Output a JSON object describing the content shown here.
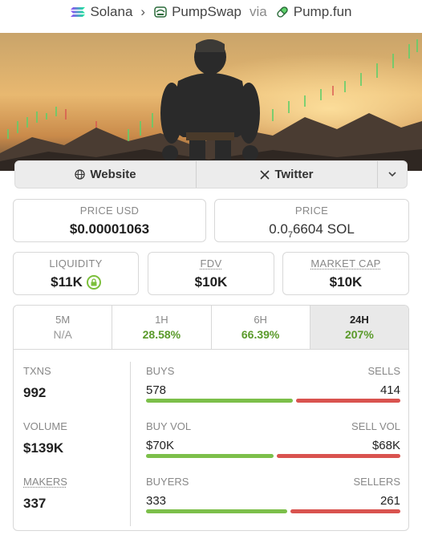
{
  "breadcrumb": {
    "chain": "Solana",
    "dex": "PumpSwap",
    "via": "via",
    "source": "Pump.fun"
  },
  "links": {
    "website": "Website",
    "twitter": "Twitter",
    "more_icon": "chevron-down-icon"
  },
  "price_usd": {
    "label": "PRICE USD",
    "value": "$0.00001063"
  },
  "price_sol": {
    "label": "PRICE",
    "prefix": "0.0",
    "zeros": "7",
    "digits": "6604",
    "unit": "SOL"
  },
  "liquidity": {
    "label": "LIQUIDITY",
    "value": "$11K"
  },
  "fdv": {
    "label": "FDV",
    "value": "$10K"
  },
  "market_cap": {
    "label": "MARKET CAP",
    "value": "$10K"
  },
  "timeframes": [
    {
      "label": "5M",
      "value": "N/A",
      "active": false
    },
    {
      "label": "1H",
      "value": "28.58%",
      "active": false
    },
    {
      "label": "6H",
      "value": "66.39%",
      "active": false
    },
    {
      "label": "24H",
      "value": "207%",
      "active": true
    }
  ],
  "stats": {
    "txns": {
      "label": "TXNS",
      "value": "992"
    },
    "buys": {
      "label": "BUYS",
      "value": "578"
    },
    "sells": {
      "label": "SELLS",
      "value": "414"
    },
    "buys_fraction": 0.583,
    "volume": {
      "label": "VOLUME",
      "value": "$139K"
    },
    "buy_vol": {
      "label": "BUY VOL",
      "value": "$70K"
    },
    "sell_vol": {
      "label": "SELL VOL",
      "value": "$68K"
    },
    "buy_vol_fraction": 0.507,
    "makers": {
      "label": "MAKERS",
      "value": "337"
    },
    "buyers": {
      "label": "BUYERS",
      "value": "333"
    },
    "sellers": {
      "label": "SELLERS",
      "value": "261"
    },
    "buyers_fraction": 0.561
  },
  "colors": {
    "positive": "#5a9a2a",
    "buy_bar": "#7cbf4a",
    "sell_bar": "#d9534f"
  }
}
